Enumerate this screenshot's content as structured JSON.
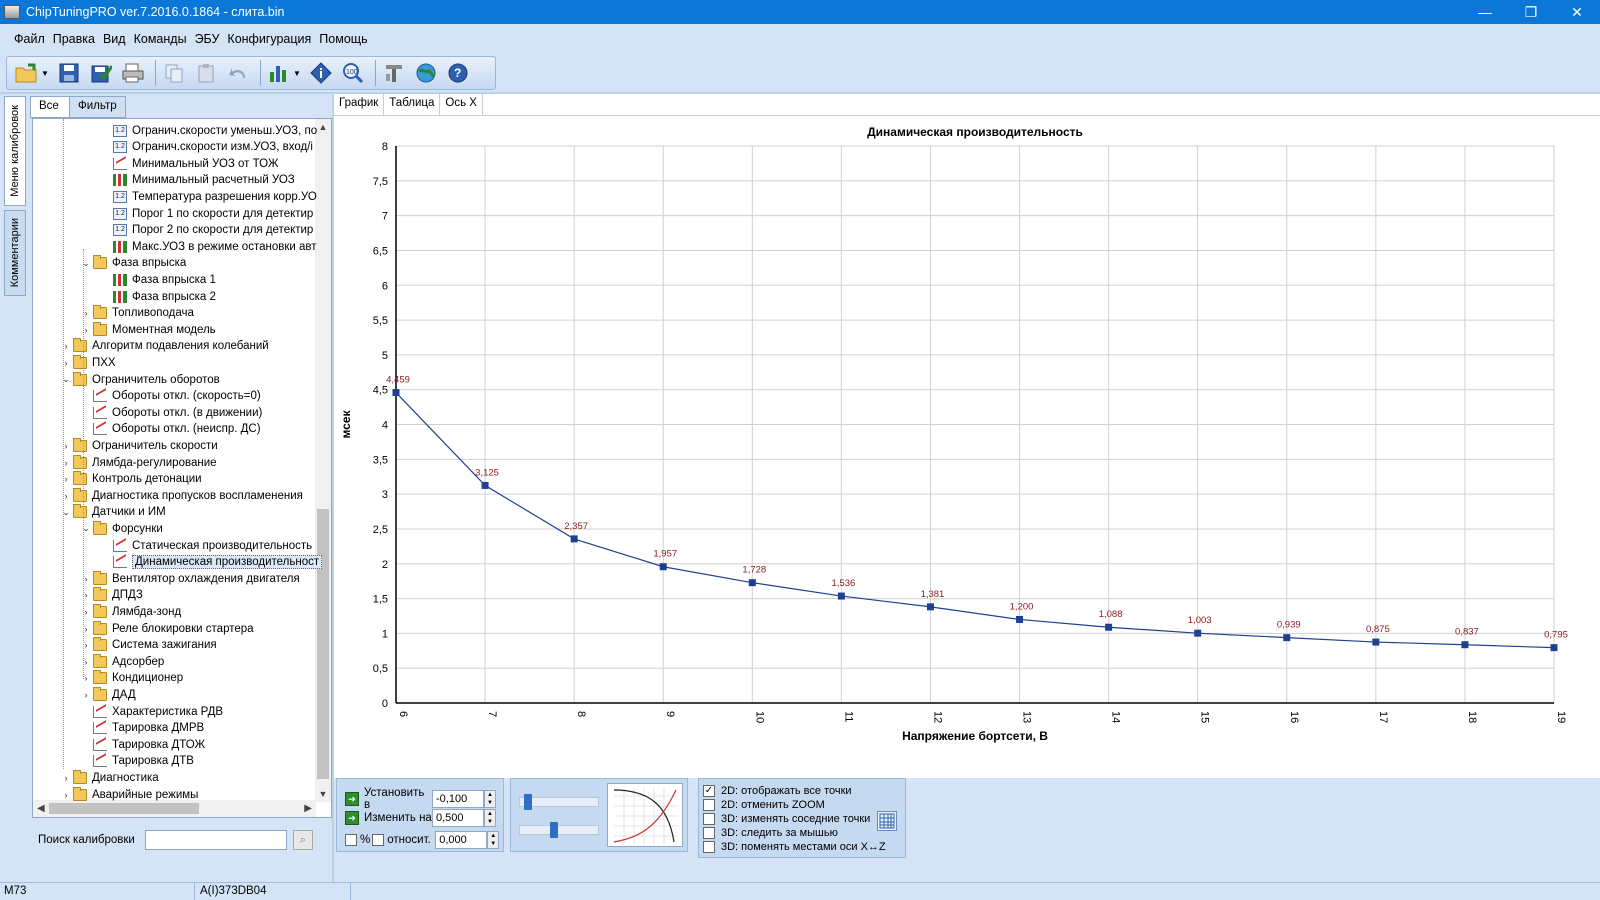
{
  "window": {
    "title": "ChipTuningPRO ver.7.2016.0.1864 - слита.bin",
    "controls": [
      "—",
      "❐",
      "✕"
    ]
  },
  "menu": [
    "Файл",
    "Правка",
    "Вид",
    "Команды",
    "ЭБУ",
    "Конфигурация",
    "Помощь"
  ],
  "toolbar": {
    "icons": [
      "open-icon",
      "save-icon",
      "save-as-icon",
      "print-icon",
      "copy-icon",
      "paste-icon",
      "undo-icon",
      "chart-options-icon",
      "info-icon",
      "zoom-100-icon",
      "tools-icon",
      "web-icon",
      "help-icon"
    ]
  },
  "side_tabs": {
    "calibration_menu": "Меню калибровок",
    "comments": "Комментарии"
  },
  "filter_tabs": {
    "all": "Все",
    "filter": "Фильтр"
  },
  "tree": [
    {
      "label": "Огранич.скорости уменьш.УОЗ, по",
      "icon": "table",
      "level": 3
    },
    {
      "label": "Огранич.скорости изм.УОЗ, вход/і",
      "icon": "table",
      "level": 3
    },
    {
      "label": "Минимальный УОЗ от ТОЖ",
      "icon": "graph",
      "level": 3
    },
    {
      "label": "Минимальный расчетный УОЗ",
      "icon": "bars",
      "level": 3
    },
    {
      "label": "Температура разрешения корр.УО",
      "icon": "table",
      "level": 3
    },
    {
      "label": "Порог 1 по скорости для детектир",
      "icon": "table",
      "level": 3
    },
    {
      "label": "Порог 2 по скорости для детектир",
      "icon": "table",
      "level": 3
    },
    {
      "label": "Макс.УОЗ в режиме остановки авт",
      "icon": "bars",
      "level": 3
    },
    {
      "label": "Фаза впрыска",
      "icon": "folder",
      "level": 2,
      "exp": "v"
    },
    {
      "label": "Фаза впрыска 1",
      "icon": "bars",
      "level": 3
    },
    {
      "label": "Фаза впрыска 2",
      "icon": "bars",
      "level": 3
    },
    {
      "label": "Топливоподача",
      "icon": "folder",
      "level": 2,
      "exp": ">"
    },
    {
      "label": "Моментная модель",
      "icon": "folder",
      "level": 2,
      "exp": ">"
    },
    {
      "label": "Алгоритм подавления колебаний",
      "icon": "folder",
      "level": 1,
      "exp": ">"
    },
    {
      "label": "ПХХ",
      "icon": "folder",
      "level": 1,
      "exp": ">"
    },
    {
      "label": "Ограничитель оборотов",
      "icon": "folder",
      "level": 1,
      "exp": "v"
    },
    {
      "label": "Обороты откл. (скорость=0)",
      "icon": "graph",
      "level": 2
    },
    {
      "label": "Обороты откл. (в движении)",
      "icon": "graph",
      "level": 2
    },
    {
      "label": "Обороты откл. (неиспр. ДС)",
      "icon": "graph",
      "level": 2
    },
    {
      "label": "Ограничитель скорости",
      "icon": "folder",
      "level": 1,
      "exp": ">"
    },
    {
      "label": "Лямбда-регулирование",
      "icon": "folder",
      "level": 1,
      "exp": ">"
    },
    {
      "label": "Контроль детонации",
      "icon": "folder",
      "level": 1,
      "exp": ">"
    },
    {
      "label": "Диагностика пропусков воспламенения",
      "icon": "folder",
      "level": 1,
      "exp": ">"
    },
    {
      "label": "Датчики и ИМ",
      "icon": "folder",
      "level": 1,
      "exp": "v"
    },
    {
      "label": "Форсунки",
      "icon": "folder",
      "level": 2,
      "exp": "v"
    },
    {
      "label": "Статическая производительность",
      "icon": "graph",
      "level": 3
    },
    {
      "label": "Динамическая производительност",
      "icon": "graph",
      "level": 3,
      "selected": true
    },
    {
      "label": "Вентилятор охлаждения двигателя",
      "icon": "folder",
      "level": 2,
      "exp": ">"
    },
    {
      "label": "ДПДЗ",
      "icon": "folder",
      "level": 2,
      "exp": ">"
    },
    {
      "label": "Лямбда-зонд",
      "icon": "folder",
      "level": 2,
      "exp": ">"
    },
    {
      "label": "Реле блокировки стартера",
      "icon": "folder",
      "level": 2,
      "exp": ">"
    },
    {
      "label": "Система зажигания",
      "icon": "folder",
      "level": 2,
      "exp": ">"
    },
    {
      "label": "Адсорбер",
      "icon": "folder",
      "level": 2,
      "exp": ">"
    },
    {
      "label": "Кондиционер",
      "icon": "folder",
      "level": 2,
      "exp": ">"
    },
    {
      "label": "ДАД",
      "icon": "folder",
      "level": 2,
      "exp": ">"
    },
    {
      "label": "Характеристика РДВ",
      "icon": "graph",
      "level": 2
    },
    {
      "label": "Тарировка ДМРВ",
      "icon": "graph",
      "level": 2
    },
    {
      "label": "Тарировка ДТОЖ",
      "icon": "graph",
      "level": 2
    },
    {
      "label": "Тарировка ДТВ",
      "icon": "graph",
      "level": 2
    },
    {
      "label": "Диагностика",
      "icon": "folder",
      "level": 1,
      "exp": ">"
    },
    {
      "label": "Аварийные режимы",
      "icon": "folder",
      "level": 1,
      "exp": ">"
    }
  ],
  "search": {
    "label": "Поиск калибровки",
    "value": "",
    "placeholder": ""
  },
  "main_tabs": [
    "График",
    "Таблица",
    "Ось X"
  ],
  "chart_data": {
    "type": "line",
    "title": "Динамическая производительность",
    "xlabel": "Напряжение бортсети, В",
    "ylabel": "мсек",
    "x": [
      6,
      7,
      8,
      9,
      10,
      11,
      12,
      13,
      14,
      15,
      16,
      17,
      18,
      19
    ],
    "y": [
      4.459,
      3.125,
      2.357,
      1.957,
      1.728,
      1.536,
      1.381,
      1.2,
      1.088,
      1.003,
      0.939,
      0.875,
      0.837,
      0.795
    ],
    "point_labels": [
      "4,459",
      "3,125",
      "2,357",
      "1,957",
      "1,728",
      "1,536",
      "1,381",
      "1,200",
      "1,088",
      "1,003",
      "0,939",
      "0,875",
      "0,837",
      "0,795"
    ],
    "xlim": [
      6,
      19
    ],
    "ylim": [
      0,
      8
    ],
    "yticks": [
      0,
      0.5,
      1,
      1.5,
      2,
      2.5,
      3,
      3.5,
      4,
      4.5,
      5,
      5.5,
      6,
      6.5,
      7,
      7.5,
      8
    ],
    "ytick_labels": [
      "0",
      "0,5",
      "1",
      "1,5",
      "2",
      "2,5",
      "3",
      "3,5",
      "4",
      "4,5",
      "5",
      "5,5",
      "6",
      "6,5",
      "7",
      "7,5",
      "8"
    ],
    "grid": true,
    "colors": {
      "line": "#1f3f8f",
      "marker": "#1f3f8f",
      "point_label": "#8b1a1a",
      "grid": "#d0d0d0"
    }
  },
  "controls": {
    "set_to": {
      "label": "Установить в",
      "value": "-0,100"
    },
    "change_by": {
      "label": "Изменить на",
      "value": "0,500"
    },
    "percent_label": "%",
    "relative_label": "относит.",
    "relative_value": "0,000",
    "slider_top_level": 0.05,
    "slider_bottom_level": 0.42
  },
  "options": [
    {
      "label": "2D: отображать все точки",
      "checked": true
    },
    {
      "label": "2D: отменить ZOOM",
      "checked": false
    },
    {
      "label": "3D: изменять соседние точки",
      "checked": false
    },
    {
      "label": "3D: следить за мышью",
      "checked": false
    },
    {
      "label": "3D: поменять местами оси X↔Z",
      "checked": false
    }
  ],
  "status": {
    "left": "M73",
    "middle": "A(I)373DB04"
  }
}
